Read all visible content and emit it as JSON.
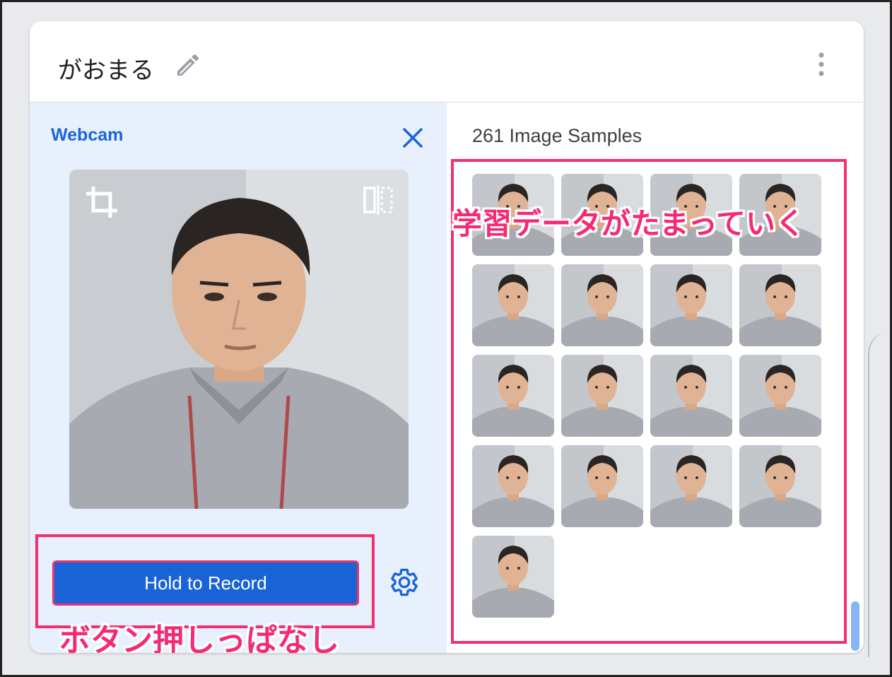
{
  "header": {
    "class_name": "がおまる",
    "edit_icon": "pencil-icon",
    "more_icon": "more-vert-icon"
  },
  "webcam": {
    "label": "Webcam",
    "close_icon": "close-icon",
    "crop_icon": "crop-icon",
    "flip_icon": "flip-icon",
    "record_button": "Hold to Record",
    "settings_icon": "gear-icon",
    "annotation": "ボタン押しっぱなし"
  },
  "samples": {
    "title": "261 Image Samples",
    "annotation": "学習データがたまっていく",
    "visible_thumbnail_count": 17
  },
  "colors": {
    "accent_blue": "#1a63d6",
    "highlight_pink": "#f0306f",
    "panel_bg": "#e8f0fe"
  }
}
